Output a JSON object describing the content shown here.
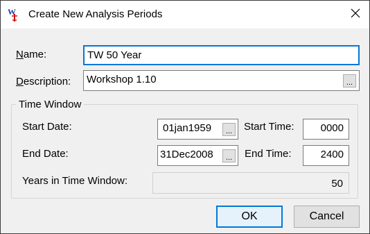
{
  "window": {
    "title": "Create New Analysis Periods",
    "icon": "app-logo-icon",
    "close_icon": "close-icon"
  },
  "form": {
    "name_label_underlined": "N",
    "name_label_rest": "ame:",
    "name_value": "TW 50 Year",
    "description_label_underlined": "D",
    "description_label_rest": "escription:",
    "description_value": "Workshop 1.10",
    "browse_label": "..."
  },
  "time_window": {
    "title": "Time Window",
    "start_date_label": "Start Date:",
    "start_date_value": "01jan1959",
    "start_time_label": "Start Time:",
    "start_time_value": "0000",
    "end_date_label": "End Date:",
    "end_date_value": "31Dec2008",
    "end_time_label": "End Time:",
    "end_time_value": "2400",
    "years_label": "Years in Time Window:",
    "years_value": "50"
  },
  "buttons": {
    "ok": "OK",
    "cancel": "Cancel"
  },
  "colors": {
    "focus_border": "#0078d7",
    "button_face": "#e1e1e1",
    "dialog_bg": "#f0f0f0"
  }
}
